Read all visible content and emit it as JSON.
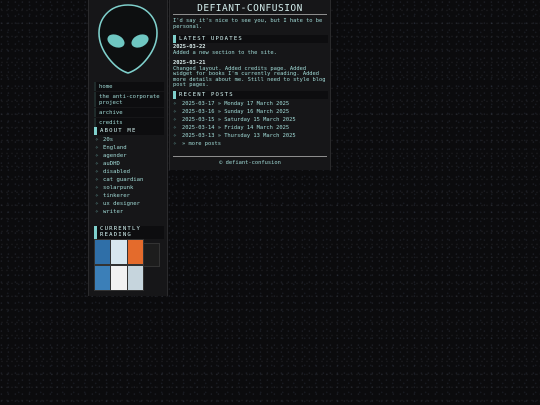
{
  "site": {
    "title": "DEFIANT-CONFUSION",
    "intro": "I'd say it's nice to see you, but I hate to be personal.",
    "footer": "© defiant-confusion"
  },
  "nav": [
    {
      "label": "home"
    },
    {
      "label": "the anti-corporate project"
    },
    {
      "label": "archive"
    },
    {
      "label": "credits"
    }
  ],
  "about": {
    "title": "ABOUT ME",
    "items": [
      "20s",
      "England",
      "agender",
      "auDHD",
      "disabled",
      "cat guardian",
      "solarpunk",
      "tinkerer",
      "ux designer",
      "writer"
    ]
  },
  "reading": {
    "title": "CURRENTLY READING",
    "colors": [
      "#2f6fa8",
      "#d7e6ee",
      "#e46b2c",
      "#1d1d1d",
      "#3b7fb8",
      "#f2f2f2",
      "#c6d5dd"
    ]
  },
  "updates": {
    "title": "LATEST UPDATES",
    "entries": [
      {
        "date": "2025-03-22",
        "text": "Added a new section to the site."
      },
      {
        "date": "2025-03-21",
        "text": "Changed layout. Added credits page. Added widget for books I'm currently reading. Added more details about me. Still need to style blog post pages."
      }
    ]
  },
  "posts": {
    "title": "RECENT POSTS",
    "items": [
      {
        "label": "2025-03-17 » Monday 17 March 2025"
      },
      {
        "label": "2025-03-16 » Sunday 16 March 2025"
      },
      {
        "label": "2025-03-15 » Saturday 15 March 2025"
      },
      {
        "label": "2025-03-14 » Friday 14 March 2025"
      },
      {
        "label": "2025-03-13 » Thursday 13 March 2025"
      }
    ],
    "more": "» more posts"
  },
  "icons": {
    "bullet": "diamond-star-icon",
    "logo": "alien-head-icon"
  },
  "colors": {
    "accent": "#7fd0cc",
    "panel": "#161618",
    "text": "#9fd8d4"
  }
}
